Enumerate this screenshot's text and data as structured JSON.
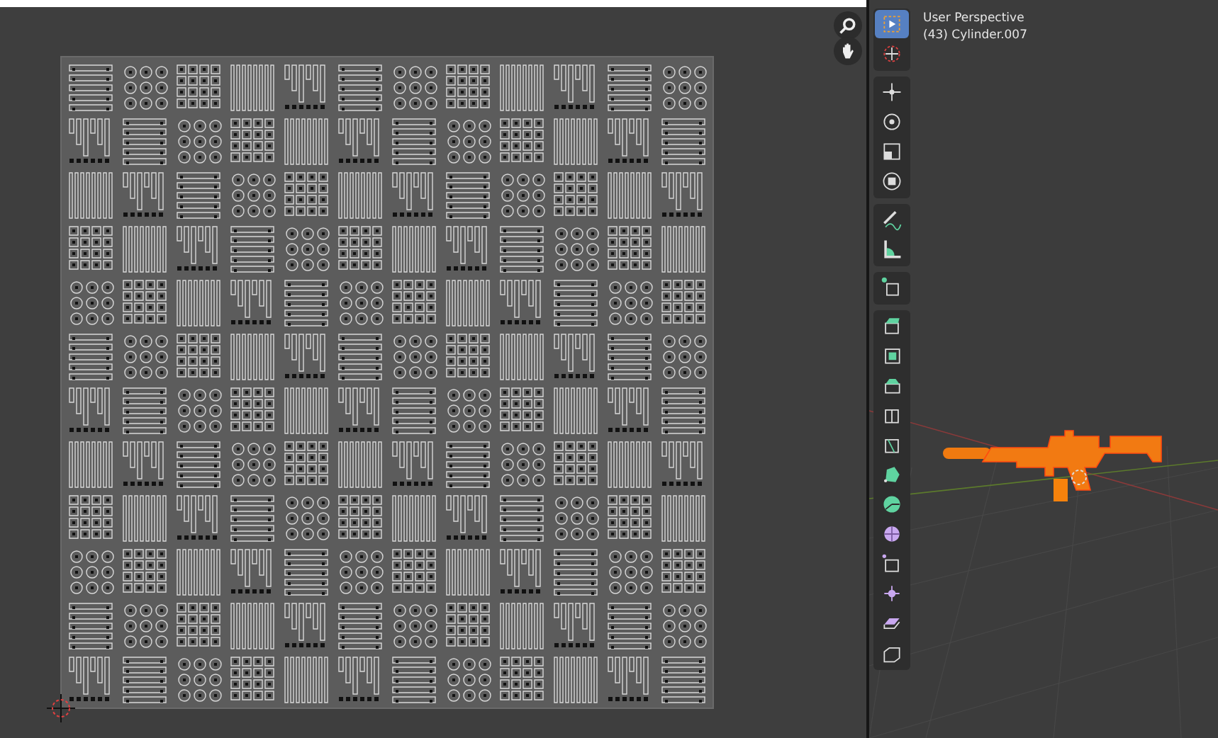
{
  "viewport": {
    "title": "User Perspective",
    "object": "(43) Cylinder.007"
  },
  "toolbar": {
    "groups": [
      [
        {
          "kind": "select",
          "selected": true
        },
        {
          "kind": "cursor",
          "selected": false
        }
      ],
      [
        {
          "kind": "move",
          "selected": false
        },
        {
          "kind": "rotate",
          "selected": false
        },
        {
          "kind": "scale",
          "selected": false
        },
        {
          "kind": "transform",
          "selected": false
        }
      ],
      [
        {
          "kind": "annotate",
          "selected": false
        },
        {
          "kind": "measure",
          "selected": false
        }
      ],
      [
        {
          "kind": "add",
          "selected": false
        }
      ],
      [
        {
          "kind": "extrude",
          "selected": false
        },
        {
          "kind": "inset",
          "selected": false
        },
        {
          "kind": "bevel",
          "selected": false
        },
        {
          "kind": "loopcut",
          "selected": false
        },
        {
          "kind": "knife",
          "selected": false
        },
        {
          "kind": "polybuild",
          "selected": false
        },
        {
          "kind": "spin",
          "selected": false
        },
        {
          "kind": "smooth",
          "selected": false
        },
        {
          "kind": "slide",
          "selected": false
        },
        {
          "kind": "shrink",
          "selected": false
        },
        {
          "kind": "shear",
          "selected": false
        },
        {
          "kind": "rip",
          "selected": false
        }
      ]
    ]
  }
}
